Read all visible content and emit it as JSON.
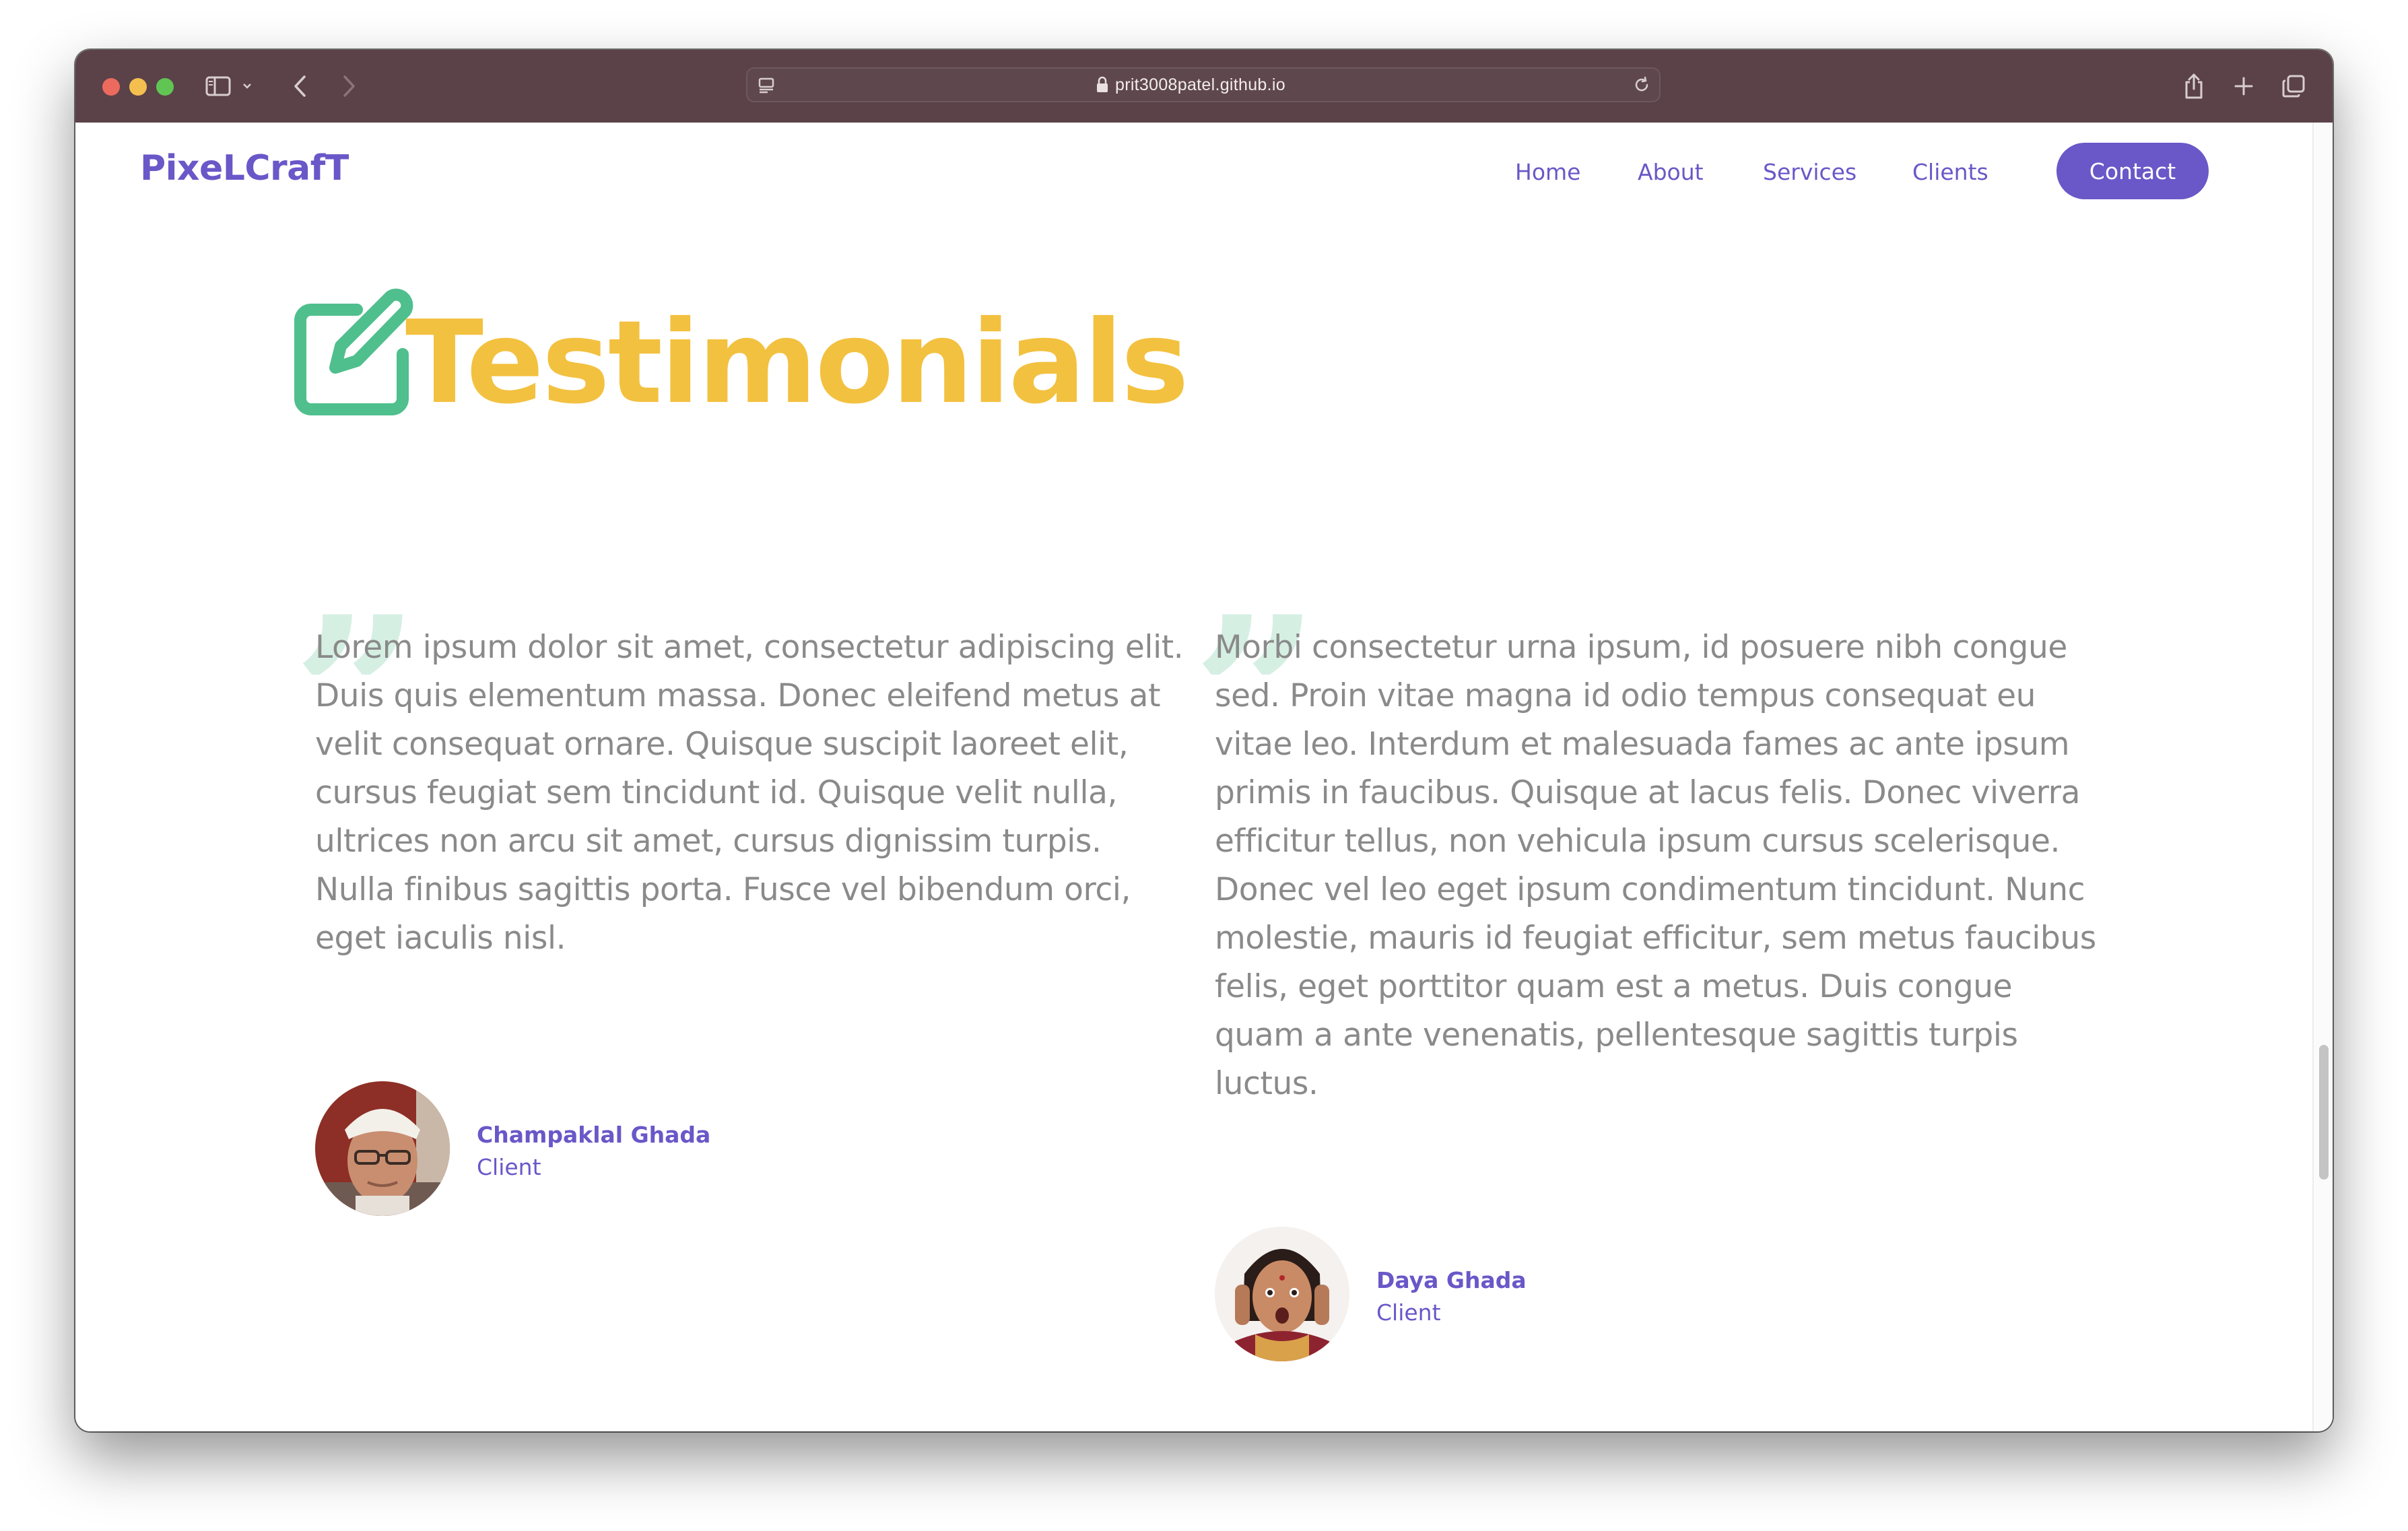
{
  "browser": {
    "url": "prit3008patel.github.io"
  },
  "nav": {
    "logo": "PixeLCrafT",
    "links": [
      "Home",
      "About",
      "Services",
      "Clients"
    ],
    "contact_label": "Contact"
  },
  "section": {
    "title": "Testimonials",
    "title_color": "#f3c140",
    "icon_color": "#4fbf8d"
  },
  "testimonials": [
    {
      "text": "Lorem ipsum dolor sit amet, consectetur adipiscing elit. Duis quis elementum massa. Donec eleifend metus at velit consequat ornare. Quisque suscipit laoreet elit, cursus feugiat sem tincidunt id. Quisque velit nulla, ultrices non arcu sit amet, cursus dignissim turpis. Nulla finibus sagittis porta. Fusce vel bibendum orci, eget iaculis nisl.",
      "name": "Champaklal Ghada",
      "role": "Client"
    },
    {
      "text": "Morbi consectetur urna ipsum, id posuere nibh congue sed. Proin vitae magna id odio tempus consequat eu vitae leo. Interdum et malesuada fames ac ante ipsum primis in faucibus. Quisque at lacus felis. Donec viverra efficitur tellus, non vehicula ipsum cursus scelerisque. Donec vel leo eget ipsum condimentum tincidunt. Nunc molestie, mauris id feugiat efficitur, sem metus faucibus felis, eget porttitor quam est a metus. Duis congue quam a ante venenatis, pellentesque sagittis turpis luctus.",
      "name": "Daya Ghada",
      "role": "Client"
    }
  ],
  "colors": {
    "brand": "#6a57c8",
    "quote_mark": "#d6efe3",
    "body_text": "#8a8a8a",
    "titlebar": "#5a4248"
  }
}
